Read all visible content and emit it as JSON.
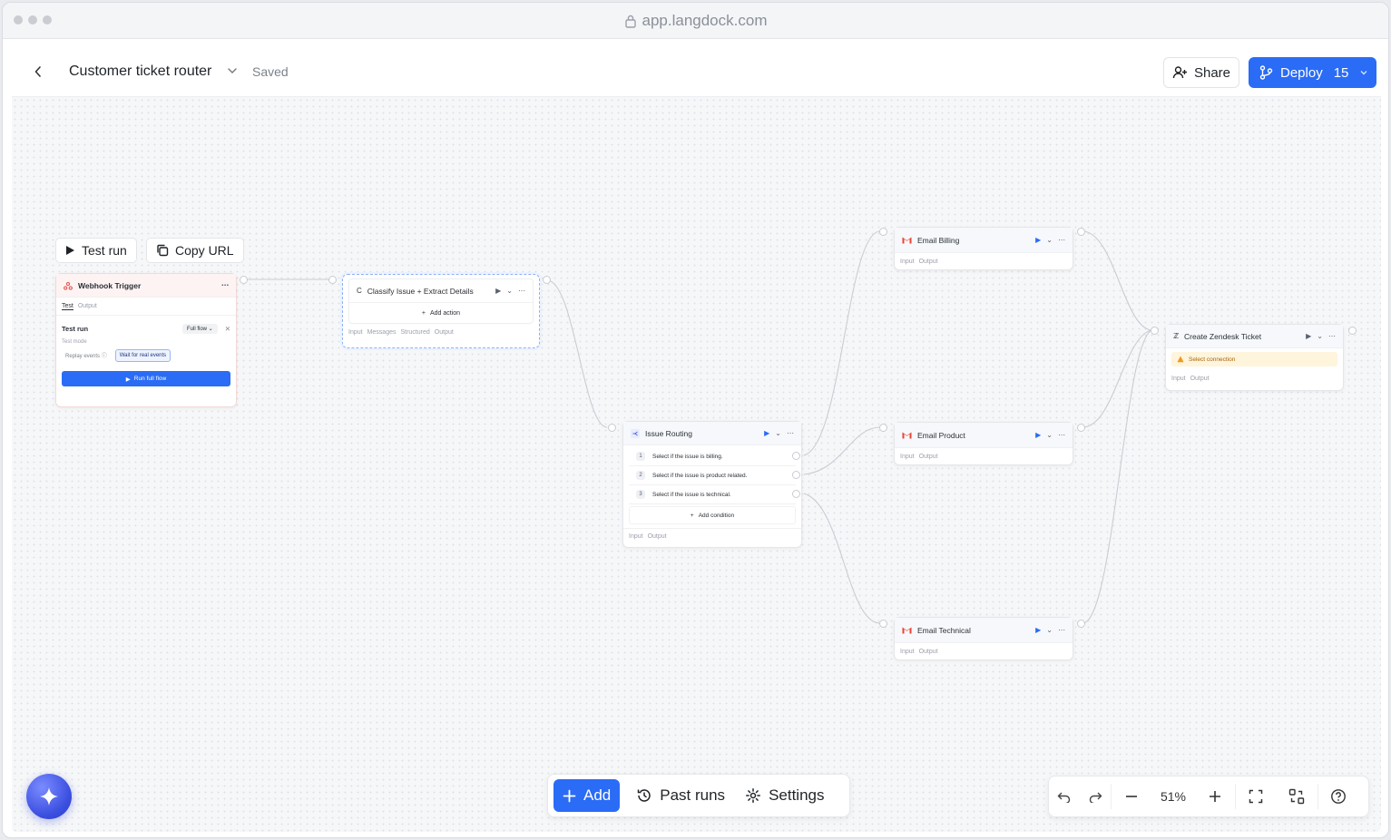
{
  "browser": {
    "url": "app.langdock.com"
  },
  "header": {
    "title": "Customer ticket router",
    "status": "Saved",
    "share_label": "Share",
    "deploy_label": "Deploy",
    "deploy_count": "15"
  },
  "canvas_actions": {
    "test_run_label": "Test run",
    "copy_url_label": "Copy URL"
  },
  "nodes": {
    "webhook": {
      "title": "Webhook Trigger",
      "tabs": [
        "Test",
        "Output"
      ],
      "panel": {
        "title": "Test run",
        "dropdown": "Full flow",
        "mode_label": "Test mode",
        "option_replay": "Replay events",
        "option_wait": "Wait for real events",
        "run_button": "Run full flow"
      }
    },
    "classify": {
      "icon_letter": "C",
      "title": "Classify Issue + Extract Details",
      "add_action": "Add action",
      "tabs": [
        "Input",
        "Messages",
        "Structured",
        "Output"
      ]
    },
    "routing": {
      "title": "Issue Routing",
      "conditions": [
        {
          "num": "1",
          "text": "Select if the issue is billing."
        },
        {
          "num": "2",
          "text": "Select if the issue is product related."
        },
        {
          "num": "3",
          "text": "Select if the issue is technical."
        }
      ],
      "add_condition": "Add condition",
      "tabs": [
        "Input",
        "Output"
      ]
    },
    "email_billing": {
      "title": "Email Billing",
      "tabs": [
        "Input",
        "Output"
      ]
    },
    "email_product": {
      "title": "Email Product",
      "tabs": [
        "Input",
        "Output"
      ]
    },
    "email_technical": {
      "title": "Email Technical",
      "tabs": [
        "Input",
        "Output"
      ]
    },
    "zendesk": {
      "title": "Create Zendesk Ticket",
      "warning": "Select connection",
      "tabs": [
        "Input",
        "Output"
      ]
    }
  },
  "toolbar": {
    "add_label": "Add",
    "past_runs_label": "Past runs",
    "settings_label": "Settings"
  },
  "zoom": {
    "level": "51%"
  },
  "colors": {
    "accent": "#2a6cf6",
    "warning_bg": "#fff4dc",
    "warning_text": "#a4660a",
    "gmail_red": "#ea4335"
  }
}
